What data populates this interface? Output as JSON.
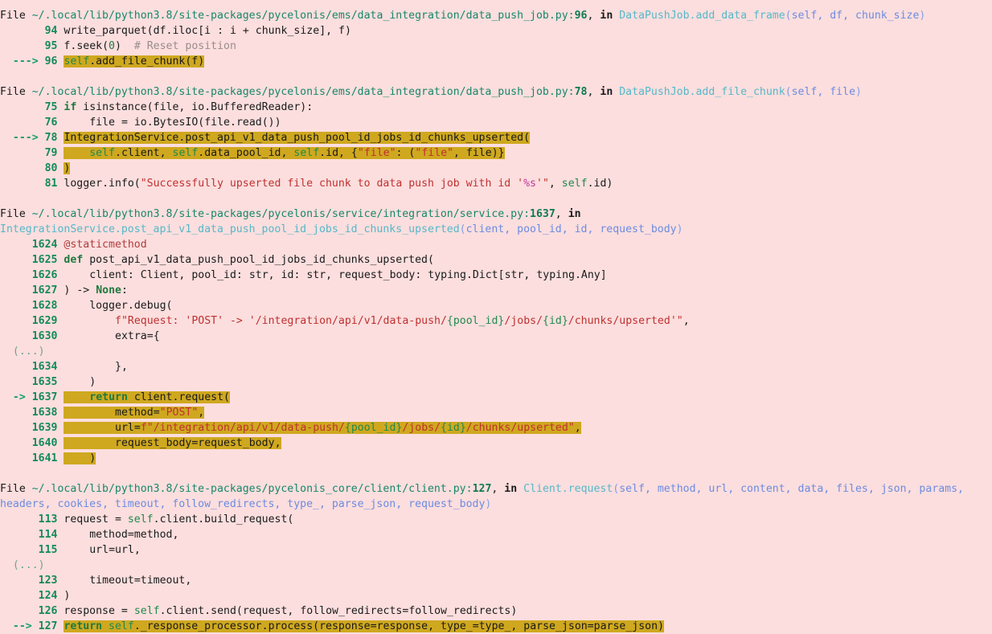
{
  "meta": {
    "kind": "python-traceback",
    "background": "#fcdede",
    "highlight_color": "#cfa81f",
    "path_color": "#16876a",
    "function_color": "#55b8c8",
    "param_color": "#6d8be0",
    "string_color": "#c03030",
    "keyword_color": "#1f7a3f"
  },
  "frames": [
    {
      "header": {
        "file_label": "File",
        "path": "~/.local/lib/python3.8/site-packages/pycelonis/ems/data_integration/data_push_job.py",
        "lineno": "96",
        "in_label": "in",
        "function": "DataPushJob.add_data_frame",
        "params": "self, df, chunk_size"
      },
      "lines": [
        {
          "marker": "",
          "no": "94",
          "code": "write_parquet(df.iloc[i : i + chunk_size], f)"
        },
        {
          "marker": "",
          "no": "95",
          "code": "f.seek(0)  # Reset position"
        },
        {
          "marker": "--->",
          "no": "96",
          "code": "self.add_file_chunk(f)",
          "highlight": true
        }
      ]
    },
    {
      "header": {
        "file_label": "File",
        "path": "~/.local/lib/python3.8/site-packages/pycelonis/ems/data_integration/data_push_job.py",
        "lineno": "78",
        "in_label": "in",
        "function": "DataPushJob.add_file_chunk",
        "params": "self, file"
      },
      "lines": [
        {
          "marker": "",
          "no": "75",
          "code": "if isinstance(file, io.BufferedReader):"
        },
        {
          "marker": "",
          "no": "76",
          "code": "    file = io.BytesIO(file.read())"
        },
        {
          "marker": "--->",
          "no": "78",
          "code": "IntegrationService.post_api_v1_data_push_pool_id_jobs_id_chunks_upserted(",
          "highlight": true
        },
        {
          "marker": "",
          "no": "79",
          "code": "    self.client, self.data_pool_id, self.id, {\"file\": (\"file\", file)}",
          "highlight": true
        },
        {
          "marker": "",
          "no": "80",
          "code": ")",
          "highlight": true
        },
        {
          "marker": "",
          "no": "81",
          "code": "logger.info(\"Successfully upserted file chunk to data push job with id '%s'\", self.id)"
        }
      ]
    },
    {
      "header": {
        "file_label": "File",
        "path": "~/.local/lib/python3.8/site-packages/pycelonis/service/integration/service.py",
        "lineno": "1637",
        "in_label": "in",
        "function": "IntegrationService.post_api_v1_data_push_pool_id_jobs_id_chunks_upserted",
        "params": "client, pool_id, id, request_body"
      },
      "lines": [
        {
          "marker": "",
          "no": "1624",
          "code": "@staticmethod"
        },
        {
          "marker": "",
          "no": "1625",
          "code": "def post_api_v1_data_push_pool_id_jobs_id_chunks_upserted("
        },
        {
          "marker": "",
          "no": "1626",
          "code": "    client: Client, pool_id: str, id: str, request_body: typing.Dict[str, typing.Any]"
        },
        {
          "marker": "",
          "no": "1627",
          "code": ") -> None:"
        },
        {
          "marker": "",
          "no": "1628",
          "code": "    logger.debug("
        },
        {
          "marker": "",
          "no": "1629",
          "code": "        f\"Request: 'POST' -> '/integration/api/v1/data-push/{pool_id}/jobs/{id}/chunks/upserted'\","
        },
        {
          "marker": "",
          "no": "1630",
          "code": "        extra={"
        },
        {
          "marker": "",
          "no": "(...)",
          "code": "",
          "ellipsis": true
        },
        {
          "marker": "",
          "no": "1634",
          "code": "        },"
        },
        {
          "marker": "",
          "no": "1635",
          "code": "    )"
        },
        {
          "marker": "->",
          "no": "1637",
          "code": "    return client.request(",
          "highlight": true
        },
        {
          "marker": "",
          "no": "1638",
          "code": "        method=\"POST\",",
          "highlight": true
        },
        {
          "marker": "",
          "no": "1639",
          "code": "        url=f\"/integration/api/v1/data-push/{pool_id}/jobs/{id}/chunks/upserted\",",
          "highlight": true
        },
        {
          "marker": "",
          "no": "1640",
          "code": "        request_body=request_body,",
          "highlight": true
        },
        {
          "marker": "",
          "no": "1641",
          "code": "    )",
          "highlight": true
        }
      ]
    },
    {
      "header": {
        "file_label": "File",
        "path": "~/.local/lib/python3.8/site-packages/pycelonis_core/client/client.py",
        "lineno": "127",
        "in_label": "in",
        "function": "Client.request",
        "params": "self, method, url, content, data, files, json, params, headers, cookies, timeout, follow_redirects, type_, parse_json, request_body"
      },
      "lines": [
        {
          "marker": "",
          "no": "113",
          "code": "request = self.client.build_request("
        },
        {
          "marker": "",
          "no": "114",
          "code": "    method=method,"
        },
        {
          "marker": "",
          "no": "115",
          "code": "    url=url,"
        },
        {
          "marker": "",
          "no": "(...)",
          "code": "",
          "ellipsis": true
        },
        {
          "marker": "",
          "no": "123",
          "code": "    timeout=timeout,"
        },
        {
          "marker": "",
          "no": "124",
          "code": ")"
        },
        {
          "marker": "",
          "no": "126",
          "code": "response = self.client.send(request, follow_redirects=follow_redirects)"
        },
        {
          "marker": "-->",
          "no": "127",
          "code": "return self._response_processor.process(response=response, type_=type_, parse_json=parse_json)",
          "highlight": true
        }
      ]
    }
  ]
}
